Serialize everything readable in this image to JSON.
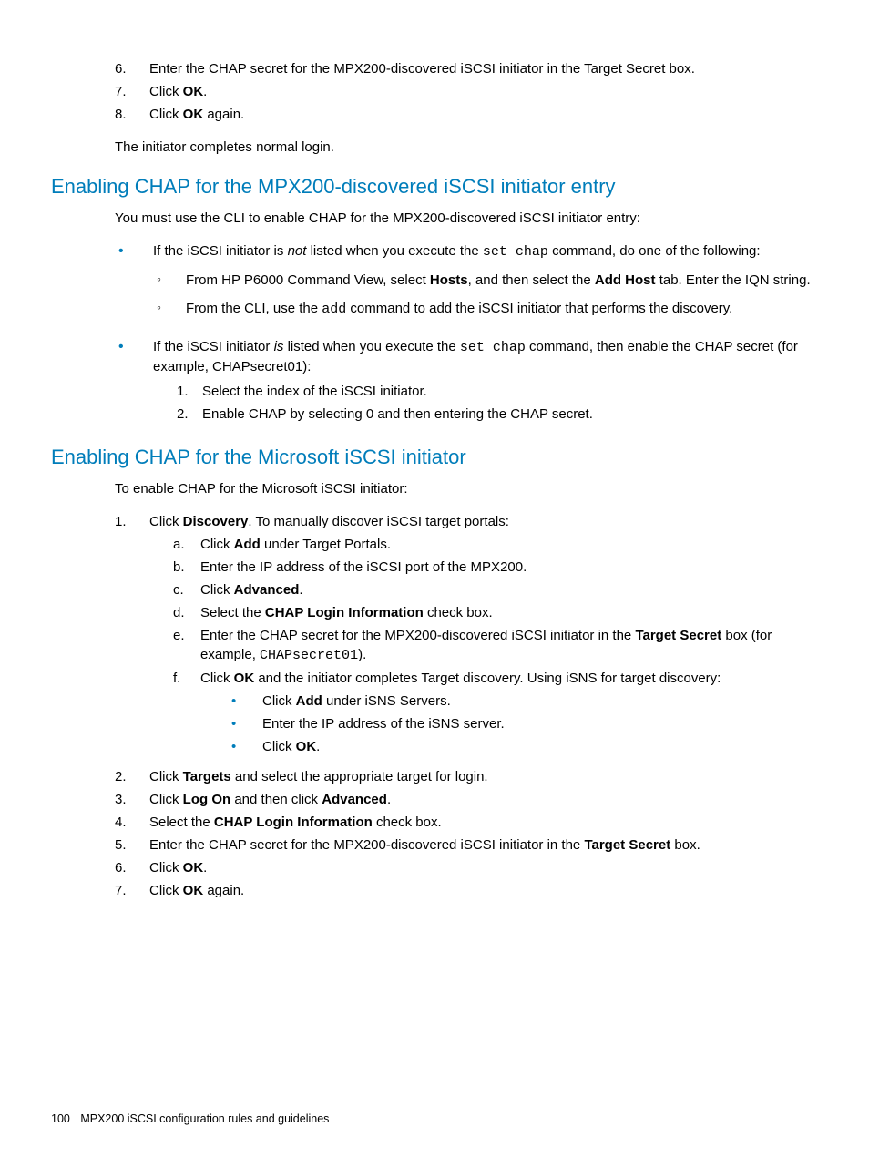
{
  "top_list": {
    "i6": {
      "n": "6.",
      "pre": "Enter the CHAP secret for the MPX200-discovered iSCSI initiator in the Target Secret box."
    },
    "i7": {
      "n": "7.",
      "pre": "Click ",
      "b": "OK",
      "post": "."
    },
    "i8": {
      "n": "8.",
      "pre": "Click ",
      "b": "OK",
      "post": " again."
    }
  },
  "top_outro": "The initiator completes normal login.",
  "h1": "Enabling CHAP for the MPX200-discovered iSCSI initiator entry",
  "h1_intro": "You must use the CLI to enable CHAP for the MPX200-discovered iSCSI initiator entry:",
  "b1_not_pre": "If the iSCSI initiator is ",
  "b1_not_i": "not",
  "b1_not_mid": " listed when you execute the ",
  "b1_not_code": "set chap",
  "b1_not_post": " command, do one of the following:",
  "b1_sub1_pre": "From HP P6000 Command View, select ",
  "b1_sub1_b1": "Hosts",
  "b1_sub1_mid": ", and then select the ",
  "b1_sub1_b2": "Add Host",
  "b1_sub1_post": " tab. Enter the IQN string.",
  "b1_sub2_pre": "From the CLI, use the ",
  "b1_sub2_code": "add",
  "b1_sub2_post": " command to add the iSCSI initiator that performs the discovery.",
  "b2_pre": "If the iSCSI initiator ",
  "b2_i": "is",
  "b2_mid": " listed when you execute the ",
  "b2_code": "set chap",
  "b2_post": " command, then enable the CHAP secret (for example, CHAPsecret01):",
  "b2_s1_n": "1.",
  "b2_s1": "Select the index of the iSCSI initiator.",
  "b2_s2_n": "2.",
  "b2_s2": "Enable CHAP by selecting 0 and then entering the CHAP secret.",
  "h2": "Enabling CHAP for the Microsoft iSCSI initiator",
  "h2_intro": "To enable CHAP for the Microsoft iSCSI initiator:",
  "s1_n": "1.",
  "s1_pre": "Click ",
  "s1_b": "Discovery",
  "s1_post": ". To manually discover iSCSI target portals:",
  "s1a_n": "a.",
  "s1a_pre": "Click ",
  "s1a_b": "Add",
  "s1a_post": " under Target Portals.",
  "s1b_n": "b.",
  "s1b": "Enter the IP address of the iSCSI port of the MPX200.",
  "s1c_n": "c.",
  "s1c_pre": "Click ",
  "s1c_b": "Advanced",
  "s1c_post": ".",
  "s1d_n": "d.",
  "s1d_pre": "Select the ",
  "s1d_b": "CHAP Login Information",
  "s1d_post": " check box.",
  "s1e_n": "e.",
  "s1e_pre": "Enter the CHAP secret for the MPX200-discovered iSCSI initiator in the ",
  "s1e_b": "Target Secret",
  "s1e_mid": " box (for example, ",
  "s1e_code": "CHAPsecret01",
  "s1e_post": ").",
  "s1f_n": "f.",
  "s1f_pre": "Click ",
  "s1f_b": "OK",
  "s1f_post": " and the initiator completes Target discovery. Using iSNS for target discovery:",
  "s1f_d1_pre": "Click ",
  "s1f_d1_b": "Add",
  "s1f_d1_post": " under iSNS Servers.",
  "s1f_d2": "Enter the IP address of the iSNS server.",
  "s1f_d3_pre": "Click ",
  "s1f_d3_b": "OK",
  "s1f_d3_post": ".",
  "s2_n": "2.",
  "s2_pre": "Click ",
  "s2_b": "Targets",
  "s2_post": " and select the appropriate target for login.",
  "s3_n": "3.",
  "s3_pre": "Click ",
  "s3_b1": "Log On",
  "s3_mid": " and then click ",
  "s3_b2": "Advanced",
  "s3_post": ".",
  "s4_n": "4.",
  "s4_pre": "Select the ",
  "s4_b": "CHAP Login Information",
  "s4_post": " check box.",
  "s5_n": "5.",
  "s5_pre": "Enter the CHAP secret for the MPX200-discovered iSCSI initiator in the ",
  "s5_b": "Target Secret",
  "s5_post": " box.",
  "s6_n": "6.",
  "s6_pre": "Click ",
  "s6_b": "OK",
  "s6_post": ".",
  "s7_n": "7.",
  "s7_pre": "Click ",
  "s7_b": "OK",
  "s7_post": " again.",
  "footer_page": "100",
  "footer_text": "MPX200 iSCSI configuration rules and guidelines"
}
